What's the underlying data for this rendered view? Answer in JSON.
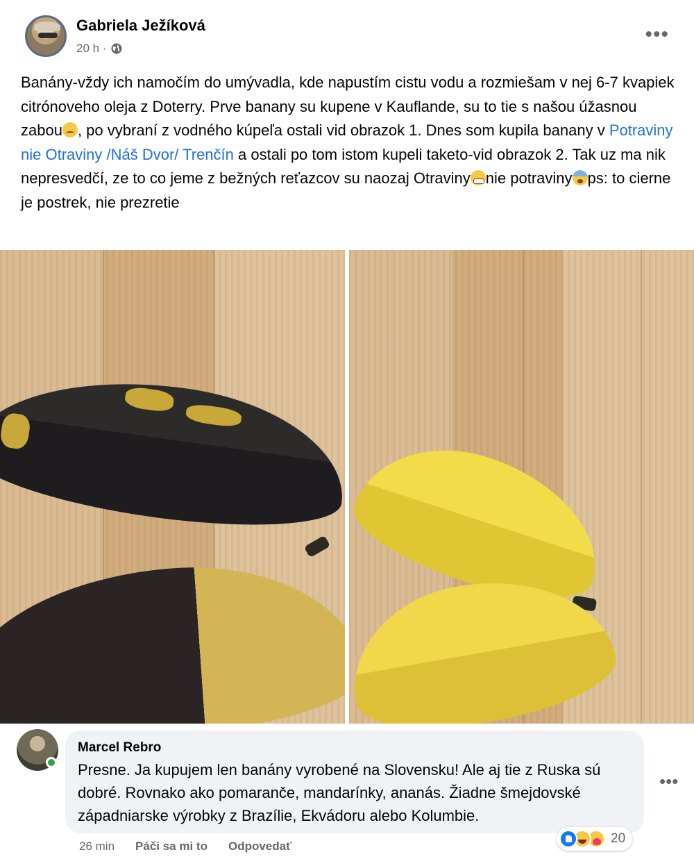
{
  "post": {
    "author": "Gabriela Ježíková",
    "time": "20 h ·",
    "text_part1": "Banány-vždy ich namočím do umývadla, kde napustím cistu vodu a rozmiešam v nej 6-7 kvapiek citrónoveho oleja z Doterry.  Prve banany su kupene v Kauflande, su to tie s našou úžasnou zabou",
    "text_part2": ", po vybraní z vodného kúpeľa ostali vid obrazok 1. Dnes som kupila banany v ",
    "link": "Potraviny nie Otraviny /Náš Dvor/ Trenčín",
    "text_part3": " a ostali po tom istom kupeli taketo-vid obrazok 2. Tak uz ma nik nepresvedčí, ze to co jeme z bežných reťazcov su naozaj Otraviny",
    "text_part4": "nie potraviny",
    "text_part5": "ps: to cierne je postrek, nie prezretie",
    "more_icon": "ellipsis-icon",
    "privacy_icon": "globe-icon"
  },
  "comment": {
    "author": "Marcel Rebro",
    "text": "Presne. Ja kupujem len banány vyrobené na Slovensku! Ale aj tie z Ruska sú dobré. Rovnako ako pomaranče, mandarínky, ananás. Žiadne šmejdovské západniarske výrobky z Brazílie, Ekvádoru alebo Kolumbie.",
    "time": "26 min",
    "like_label": "Páči sa mi to",
    "reply_label": "Odpovedať",
    "reaction_count": "20",
    "reactions": [
      "like-icon",
      "haha-icon",
      "care-icon"
    ],
    "online": true
  },
  "colors": {
    "link": "#216fdb",
    "meta": "#65676b",
    "bubble": "#f0f2f5",
    "like": "#1877f2"
  }
}
